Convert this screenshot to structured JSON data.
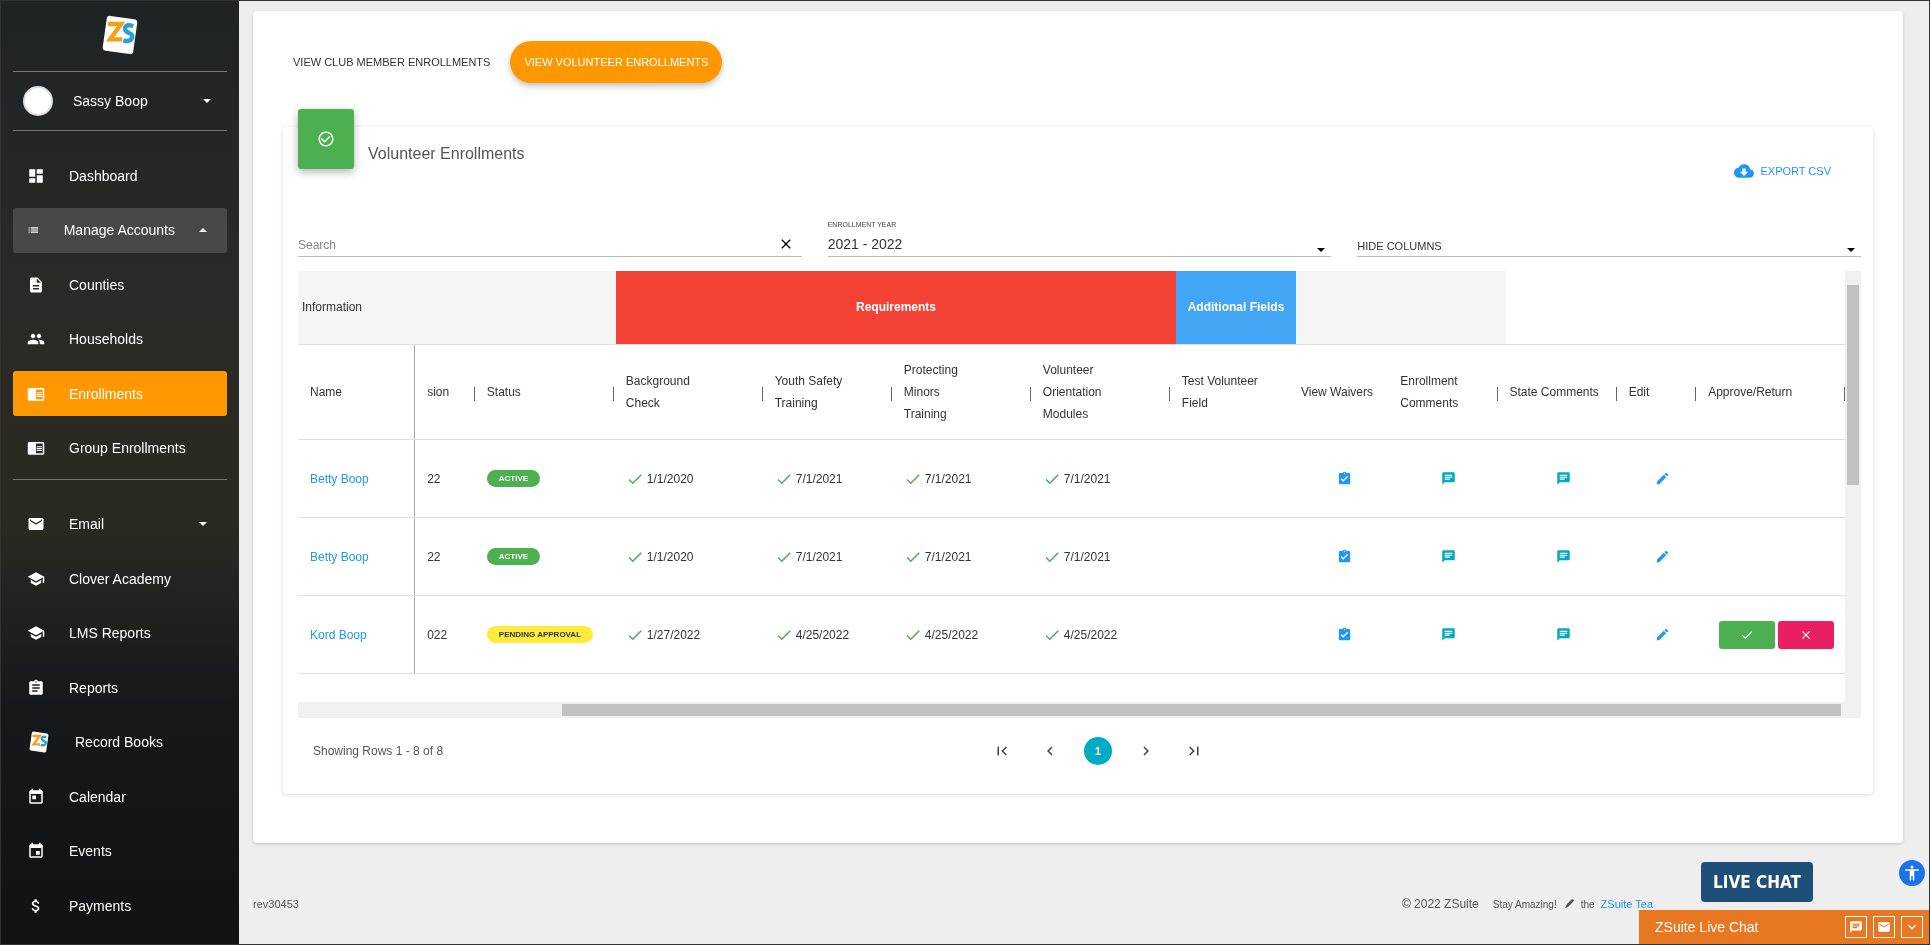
{
  "sidebar": {
    "user": {
      "name": "Sassy Boop"
    },
    "sections": [
      [
        {
          "label": "Dashboard",
          "selected": false
        },
        {
          "label": "Manage Accounts",
          "selected": false,
          "expanded": true
        },
        {
          "label": "Counties",
          "selected": false
        },
        {
          "label": "Households",
          "selected": false
        },
        {
          "label": "Enrollments",
          "selected": true
        },
        {
          "label": "Group Enrollments",
          "selected": false
        }
      ],
      [
        {
          "label": "Email",
          "selected": false,
          "expanded": false
        },
        {
          "label": "Clover Academy",
          "selected": false
        },
        {
          "label": "LMS Reports",
          "selected": false
        },
        {
          "label": "Reports",
          "selected": false
        },
        {
          "label": "Record Books",
          "selected": false
        },
        {
          "label": "Calendar",
          "selected": false
        },
        {
          "label": "Events",
          "selected": false
        },
        {
          "label": "Payments",
          "selected": false
        }
      ]
    ]
  },
  "tabs": [
    {
      "label": "VIEW CLUB MEMBER ENROLLMENTS",
      "selected": false
    },
    {
      "label": "VIEW VOLUNTEER ENROLLMENTS",
      "selected": true
    }
  ],
  "card": {
    "title": "Volunteer Enrollments",
    "export_label": "EXPORT CSV"
  },
  "filters": {
    "search": {
      "placeholder": "Search"
    },
    "enrollment_year": {
      "label": "ENROLLMENT YEAR",
      "value": "2021 - 2022"
    },
    "hide_columns": {
      "placeholder": "HIDE COLUMNS"
    }
  },
  "table": {
    "groups": [
      {
        "label": "Information",
        "color": "#f5f5f5"
      },
      {
        "label": "Requirements",
        "color": "#f44336"
      },
      {
        "label": "Additional Fields",
        "color": "#42a5f5"
      }
    ],
    "columns": [
      "Name",
      "sion",
      "Status",
      "Background Check",
      "Youth Safety Training",
      "Protecting Minors Training",
      "Volunteer Orientation Modules",
      "Test Volunteer Field",
      "View Waivers",
      "Enrollment Comments",
      "State Comments",
      "Edit",
      "Approve/Return"
    ],
    "rows": [
      {
        "name": "Betty Boop",
        "session": "22",
        "status": {
          "label": "ACTIVE",
          "kind": "active"
        },
        "requirements": [
          {
            "date": "1/1/2020",
            "met": true
          },
          {
            "date": "7/1/2021",
            "met": true
          },
          {
            "date": "7/1/2021",
            "met": true
          },
          {
            "date": "7/1/2021",
            "met": true
          }
        ],
        "approvable": false
      },
      {
        "name": "Betty Boop",
        "session": "22",
        "status": {
          "label": "ACTIVE",
          "kind": "active"
        },
        "requirements": [
          {
            "date": "1/1/2020",
            "met": true
          },
          {
            "date": "7/1/2021",
            "met": true
          },
          {
            "date": "7/1/2021",
            "met": true
          },
          {
            "date": "7/1/2021",
            "met": true
          }
        ],
        "approvable": false
      },
      {
        "name": "Kord Boop",
        "session": "022",
        "status": {
          "label": "PENDING APPROVAL",
          "kind": "pending"
        },
        "requirements": [
          {
            "date": "1/27/2022",
            "met": true
          },
          {
            "date": "4/25/2022",
            "met": true
          },
          {
            "date": "4/25/2022",
            "met": true
          },
          {
            "date": "4/25/2022",
            "met": true
          }
        ],
        "approvable": true
      }
    ]
  },
  "pagination": {
    "summary": "Showing Rows 1 - 8 of 8",
    "pages": [
      {
        "label": "1",
        "selected": true
      }
    ]
  },
  "footer": {
    "revision": "rev30453",
    "copyright": "© 2022 ZSuite",
    "tagline": "Stay Amazing!",
    "the": "the",
    "link": "ZSuite Tea"
  },
  "live_chat": {
    "bubble": "LIVE CHAT",
    "title": "ZSuite Live Chat"
  }
}
